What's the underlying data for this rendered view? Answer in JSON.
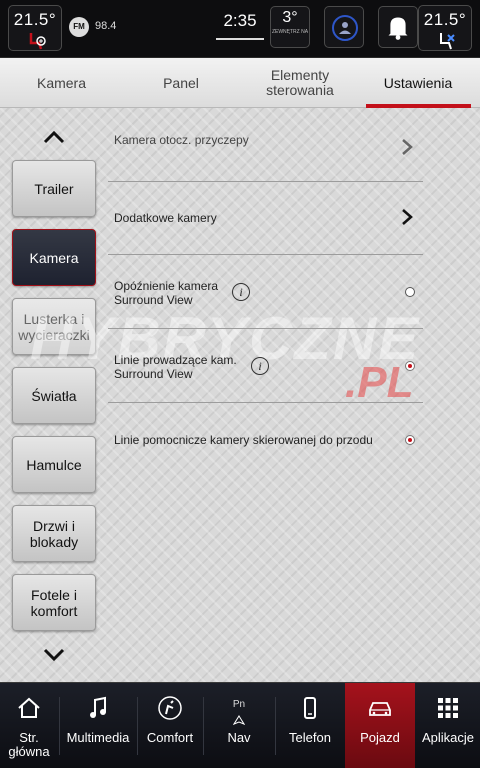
{
  "status_bar": {
    "left_temp": "21.5°",
    "radio_band": "FM",
    "radio_freq": "98.4",
    "clock": "2:35",
    "outside_temp": "3°",
    "outside_label": "ZEWNĘTRZ NA",
    "right_temp": "21.5°"
  },
  "tabs": [
    {
      "label": "Kamera"
    },
    {
      "label": "Panel"
    },
    {
      "label": "Elementy sterowania"
    },
    {
      "label": "Ustawienia"
    }
  ],
  "side_menu": [
    {
      "label": "Trailer"
    },
    {
      "label": "Kamera"
    },
    {
      "label": "Lusterka i wycieraczki"
    },
    {
      "label": "Światła"
    },
    {
      "label": "Hamulce"
    },
    {
      "label": "Drzwi i blokady"
    },
    {
      "label": "Fotele i komfort"
    }
  ],
  "settings": [
    {
      "label": "Kamera otocz. przyczepy",
      "control": "chevron"
    },
    {
      "label": "Dodatkowe kamery",
      "control": "chevron"
    },
    {
      "label": "Opóźnienie kamera Surround View",
      "control": "radio",
      "checked": false
    },
    {
      "label": "Linie prowadzące kam. Surround View",
      "control": "radio",
      "checked": true
    },
    {
      "label": "Linie pomocnicze kamery skierowanej do przodu",
      "control": "radio",
      "checked": true
    }
  ],
  "info_glyph": "i",
  "watermark": {
    "main": "HYBRYCZNE",
    "suffix": ".PL"
  },
  "bottom_nav": [
    {
      "label": "Str. główna",
      "icon": "home-icon"
    },
    {
      "label": "Multimedia",
      "icon": "music-note-icon"
    },
    {
      "label": "Comfort",
      "icon": "comfort-icon"
    },
    {
      "label": "Nav",
      "icon": "navigation-icon",
      "sub": "Pn"
    },
    {
      "label": "Telefon",
      "icon": "phone-icon"
    },
    {
      "label": "Pojazd",
      "icon": "vehicle-icon"
    },
    {
      "label": "Aplikacje",
      "icon": "apps-grid-icon"
    }
  ],
  "colors": {
    "accent": "#c3101a",
    "active_side": "#252935"
  }
}
